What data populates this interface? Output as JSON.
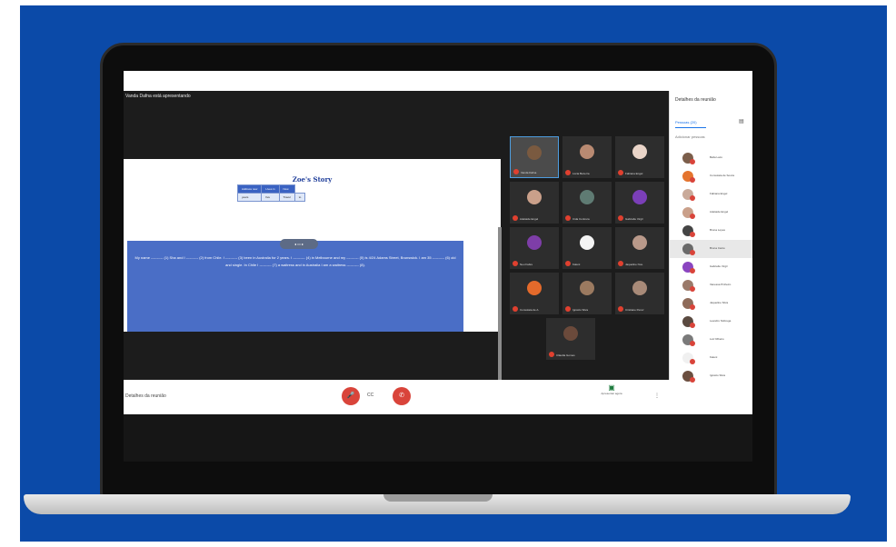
{
  "meeting": {
    "presenter_label": "Vanda Dafna está apresentando",
    "meeting_details_label": "Detalhes da reunião",
    "captions_label": "CC",
    "present_label": "Apresentar agora",
    "more_label": "⋮"
  },
  "slide": {
    "title": "Zoe's Story",
    "table_header": [
      "Address now",
      "Lives in",
      "Now"
    ],
    "table_row": [
      "years",
      "five",
      "Travel",
      "to"
    ],
    "story_text": "My name ---------- (1) Sha and I ---------- (2) from Chile. I ---------- (3) been in Australia for 2 years. I ---------- (4) in Melbourne and my ---------- (5) is 4/24 Adams Street, Brunswick. I am 35 ---------- (6) old and single. In Chile I ---------- (7) a waitress and in Australia I am a waitress ---------- (8).",
    "controls_label": "◂  ▭  ▸"
  },
  "tiles": [
    {
      "name": "Vanda Dafna",
      "color": "#7a5a40",
      "active": true
    },
    {
      "name": "Lúcia Bezerra",
      "color": "#b98a72"
    },
    {
      "name": "Fabiana Engel",
      "color": "#e9d4c8"
    },
    {
      "name": "Adelaide Engel",
      "color": "#caa08a"
    },
    {
      "name": "Cida Contrera",
      "color": "#5f7b73"
    },
    {
      "name": "Gabrielle Virgil",
      "color": "#7b3fb8"
    },
    {
      "name": "Neu Fabre",
      "color": "#7e3ea8"
    },
    {
      "name": "Kaleni",
      "color": "#f4f4f4"
    },
    {
      "name": "Jaqueline Nos.",
      "color": "#b9998a"
    },
    {
      "name": "Consolata de A.",
      "color": "#e46a2b"
    },
    {
      "name": "Ignácio Silva",
      "color": "#9b7a60"
    },
    {
      "name": "Cristiane Perez",
      "color": "#a88a78"
    },
    {
      "name": "Cláudia Gomes",
      "color": "#6b4a3b"
    }
  ],
  "participants": {
    "tab_label": "Pessoas (20)",
    "add_label": "Adicionar pessoas",
    "list": [
      {
        "name": "Bella Lazo",
        "color": "#7b5e4b"
      },
      {
        "name": "Consolata de Souza",
        "color": "#e4742e"
      },
      {
        "name": "Fabiana Engel",
        "color": "#c9aa9a"
      },
      {
        "name": "Adelaide Engel",
        "color": "#caa08a"
      },
      {
        "name": "Bruna Lopes",
        "color": "#444444"
      },
      {
        "name": "Bruna Canto",
        "color": "#6a6a6a",
        "highlight": true
      },
      {
        "name": "Gabrielle Virgil",
        "color": "#8a45c0"
      },
      {
        "name": "Vanessa Pinheiro",
        "color": "#9a7a6a"
      },
      {
        "name": "Jaqueline Silva",
        "color": "#8e6b5a"
      },
      {
        "name": "Leandro Nóbrega",
        "color": "#5a4a40"
      },
      {
        "name": "Luiz Ribeiro",
        "color": "#7a7a7a"
      },
      {
        "name": "Kaleni",
        "color": "#f0f0f0"
      },
      {
        "name": "Ignácio Silva",
        "color": "#6b4f40"
      }
    ]
  }
}
